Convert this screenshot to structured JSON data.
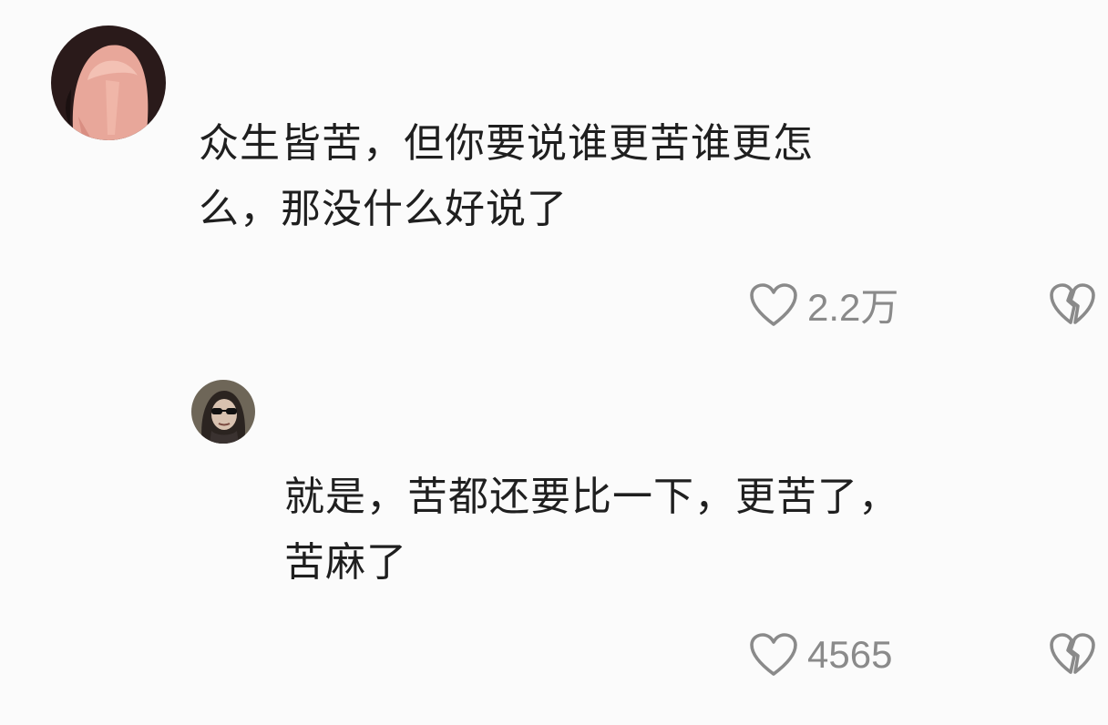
{
  "comments": [
    {
      "avatar": "pink-haired-anime-avatar",
      "text_lines": [
        "众生皆苦，但你要说谁更苦谁更怎",
        "么，那没什么好说了"
      ],
      "likes": "2.2万",
      "like_icon": "heart-outline-icon",
      "dislike_icon": "broken-heart-icon"
    },
    {
      "avatar": "sunglasses-portrait-avatar",
      "text_lines": [
        "就是，苦都还要比一下，更苦了，",
        "苦麻了"
      ],
      "likes": "4565",
      "like_icon": "heart-outline-icon",
      "dislike_icon": "broken-heart-icon"
    }
  ],
  "colors": {
    "background": "#fbfbfb",
    "text": "#1f1f1f",
    "icon_gray": "#8a8a8a"
  }
}
